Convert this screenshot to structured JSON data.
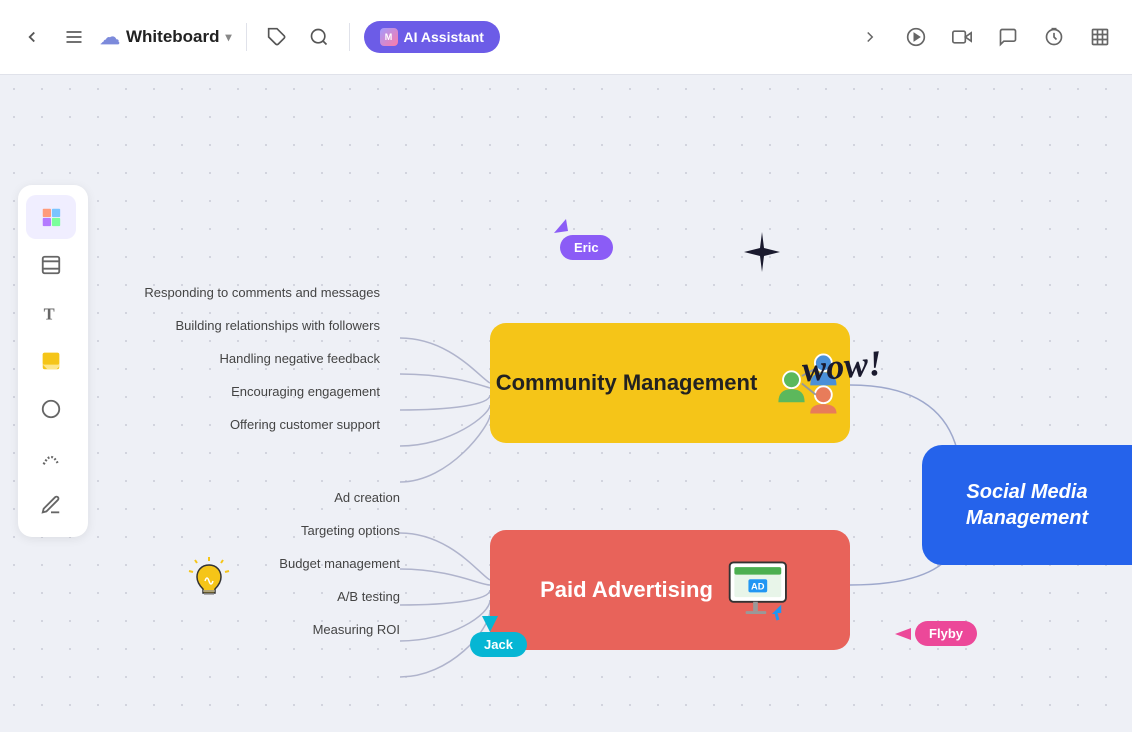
{
  "toolbar": {
    "back_label": "‹",
    "menu_label": "☰",
    "title": "Whiteboard",
    "chevron": "▾",
    "tag_icon": "tag",
    "search_icon": "search",
    "ai_button": "AI Assistant",
    "expand_icon": "›",
    "play_icon": "▶",
    "present_icon": "🎬",
    "chat_icon": "💬",
    "timer_icon": "⏱",
    "chart_icon": "📊"
  },
  "sidebar": {
    "items": [
      {
        "name": "sticky-notes",
        "icon": "🗒️"
      },
      {
        "name": "frame",
        "icon": "⬜"
      },
      {
        "name": "text",
        "icon": "T"
      },
      {
        "name": "sticky",
        "icon": "📝"
      },
      {
        "name": "shapes",
        "icon": "⭕"
      },
      {
        "name": "connector",
        "icon": "↗"
      },
      {
        "name": "pen",
        "icon": "✏️"
      }
    ]
  },
  "community_node": {
    "label": "Community Management",
    "items": [
      "Responding to comments and messages",
      "Building relationships with followers",
      "Handling negative feedback",
      "Encouraging engagement",
      "Offering customer support"
    ]
  },
  "paid_ad_node": {
    "label": "Paid Advertising",
    "items": [
      "Ad creation",
      "Targeting options",
      "Budget management",
      "A/B testing",
      "Measuring ROI"
    ]
  },
  "social_node": {
    "label": "Social Media\nManagement"
  },
  "cursors": {
    "eric": "Eric",
    "jack": "Jack",
    "flyby": "Flyby"
  },
  "decorations": {
    "wow": "wow!",
    "sparkle": "✦"
  }
}
